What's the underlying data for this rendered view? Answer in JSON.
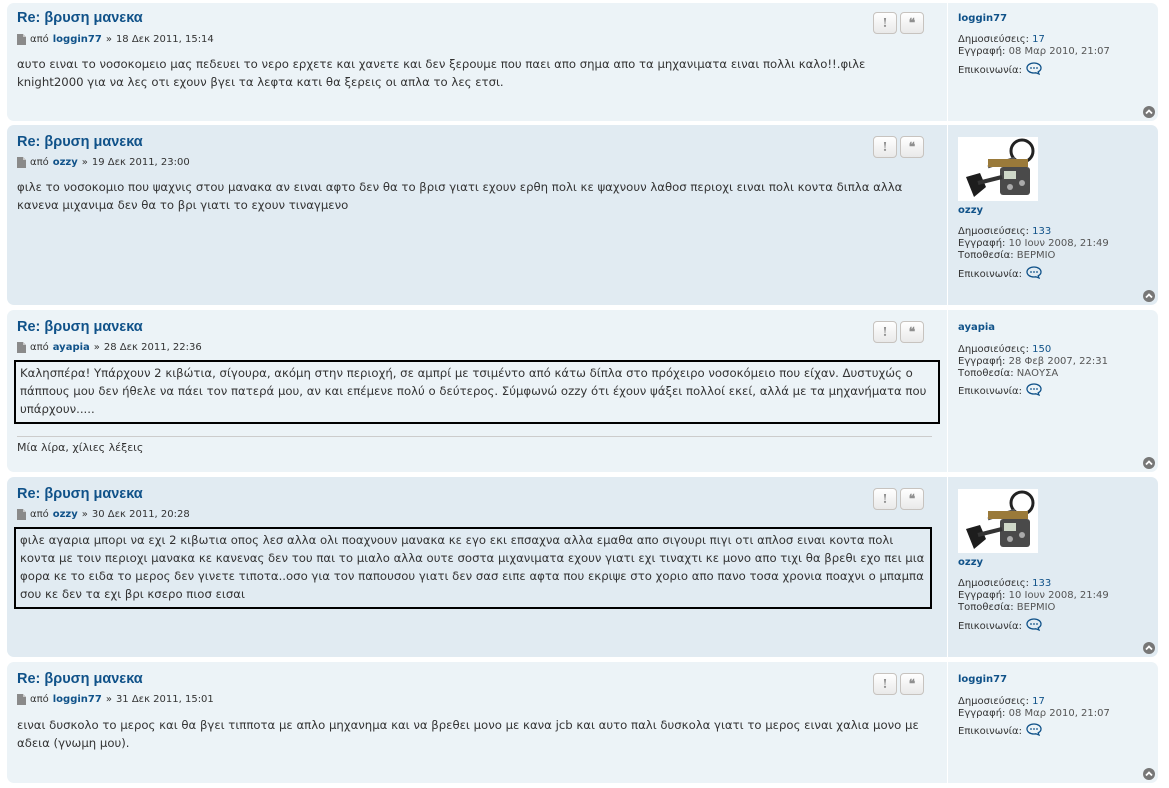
{
  "labels": {
    "by": "από",
    "sep": "»",
    "posts": "Δημοσιεύσεις:",
    "joined": "Εγγραφή:",
    "location": "Τοποθεσία:",
    "contact": "Επικοινωνία:",
    "report_btn": "!",
    "quote_btn": "❝"
  },
  "colors": {
    "bg1": "#ECF3F7",
    "bg2": "#E1EBF2",
    "link": "#105289"
  },
  "posts": [
    {
      "title": "Re: βρυση μανεκα",
      "author": "loggin77",
      "date": "18 Δεκ 2011, 15:14",
      "content": "αυτο ειναι το νοσοκομειο μας πεδευει το νερο ερχετε και χανετε και δεν ξερουμε που παει απο σημα απο τα μηχανιματα ειναι πολλι καλο!!.φιλε knight2000 για να λες οτι εχουν βγει τα λεφτα κατι θα ξερεις οι απλα το λες ετσι.",
      "profile": {
        "name": "loggin77",
        "posts": "17",
        "joined": "08 Μαρ 2010, 21:07"
      }
    },
    {
      "title": "Re: βρυση μανεκα",
      "author": "ozzy",
      "date": "19 Δεκ 2011, 23:00",
      "content": "φιλε το νοσοκομιο που ψαχνις στου μανακα αν ειναι αφτο δεν θα το βρισ γιατι εχουν ερθη πολι κε ψαχνουν λαθοσ περιοχι ειναι πολι κοντα διπλα αλλα κανενα μιχανιμα δεν θα το βρι γιατι το εχουν τιναγμενο",
      "profile": {
        "name": "ozzy",
        "posts": "133",
        "joined": "10 Ιουν 2008, 21:49",
        "location": "ΒΕΡΜΙΟ"
      }
    },
    {
      "title": "Re: βρυση μανεκα",
      "author": "ayapia",
      "date": "28 Δεκ 2011, 22:36",
      "content": "Καλησπέρα! Υπάρχουν 2 κιβώτια, σίγουρα, ακόμη στην περιοχή, σε αμπρί με τσιμέντο από κάτω δίπλα στο πρόχειρο νοσοκόμειο που είχαν. Δυστυχώς ο πάππους μου δεν ήθελε να πάει τον πατερά μου, αν και επέμενε πολύ ο δεύτερος. Σύμφωνώ ozzy ότι έχουν ψάξει πολλοί εκεί, αλλά με τα μηχανήματα που υπάρχουν.....",
      "signature": "Μία λίρα, χίλιες λέξεις",
      "profile": {
        "name": "ayapia",
        "posts": "150",
        "joined": "28 Φεβ 2007, 22:31",
        "location": "ΝΑΟΥΣΑ"
      }
    },
    {
      "title": "Re: βρυση μανεκα",
      "author": "ozzy",
      "date": "30 Δεκ 2011, 20:28",
      "content": "φιλε αγαρια μπορι να εχι 2 κιβωτια οπος λεσ αλλα ολι ποαχνουν μανακα κε εγο εκι επσαχνα αλλα εμαθα απο σιγουρι πιγι οτι απλοσ ειναι κοντα πολι κοντα με τοιν περιοχι μανακα κε κανενας δεν του παι το μιαλο αλλα ουτε σοστα μιχανιματα εχουν γιατι εχι τιναχτι κε μονο απο τιχι θα βρεθι εχο πει μια φορα κε το ειδα το μερος δεν γινετε τιποτα..οσο για τον παπουσου γιατι δεν σασ ειπε αφτα που εκριψε στο χοριο απο πανο τοσα χρονια ποαχνι ο μπαμπα σου κε δεν τα εχι βρι κσερο πιοσ εισαι",
      "profile": {
        "name": "ozzy",
        "posts": "133",
        "joined": "10 Ιουν 2008, 21:49",
        "location": "ΒΕΡΜΙΟ"
      }
    },
    {
      "title": "Re: βρυση μανεκα",
      "author": "loggin77",
      "date": "31 Δεκ 2011, 15:01",
      "content": "ειναι δυσκολο το μερος και θα βγει τιπποτα με απλο μηχανημα και να βρεθει μονο με κανα jcb και αυτο παλι δυσκολα γιατι το μερος ειναι χαλια μονο με αδεια (γνωμη μου).",
      "profile": {
        "name": "loggin77",
        "posts": "17",
        "joined": "08 Μαρ 2010, 21:07"
      }
    }
  ]
}
